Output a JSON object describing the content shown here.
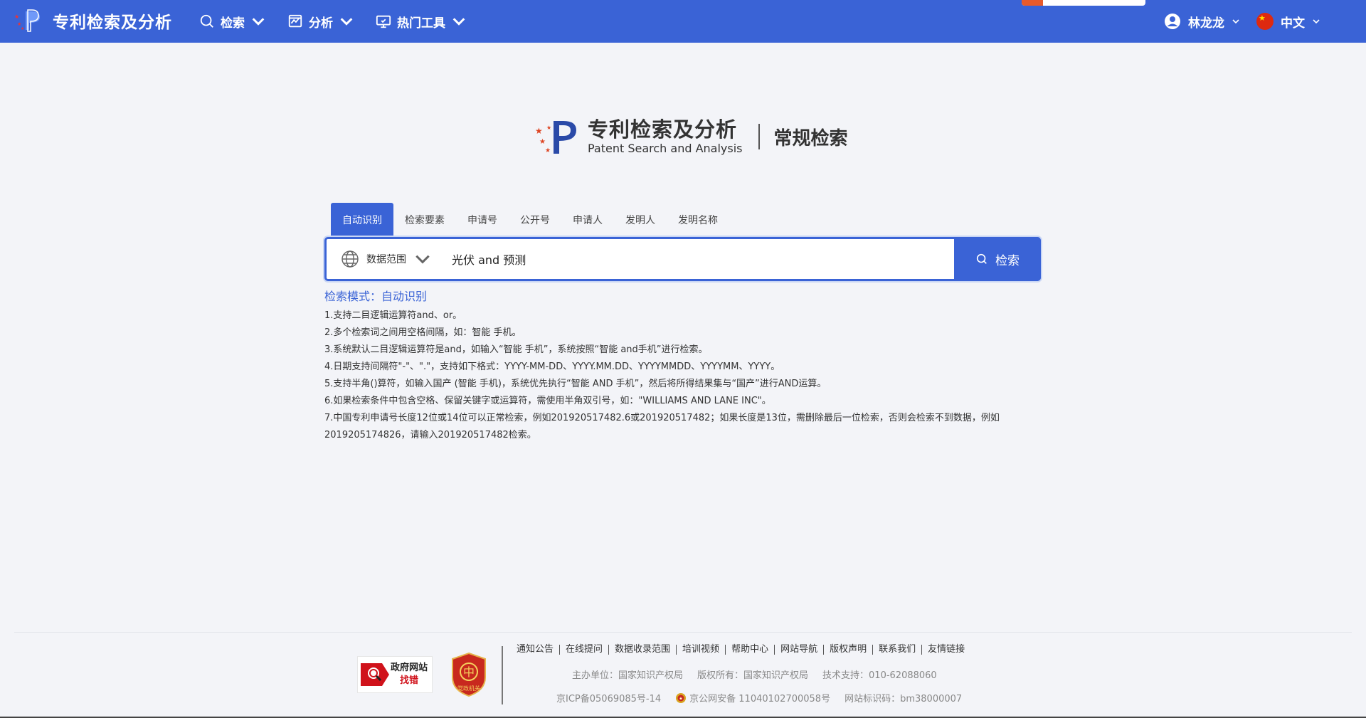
{
  "header": {
    "brand_name": "专利检索及分析",
    "nav": [
      {
        "label": "检索",
        "icon": "search-icon"
      },
      {
        "label": "分析",
        "icon": "chart-icon"
      },
      {
        "label": "热门工具",
        "icon": "monitor-icon"
      }
    ],
    "user_name": "林龙龙",
    "language": "中文"
  },
  "hero": {
    "title_cn": "专利检索及分析",
    "title_en": "Patent Search and Analysis",
    "mode": "常规检索"
  },
  "tabs": [
    "自动识别",
    "检索要素",
    "申请号",
    "公开号",
    "申请人",
    "发明人",
    "发明名称"
  ],
  "search": {
    "scope_label": "数据范围",
    "query": "光伏 and 预测",
    "button_label": "检索"
  },
  "mode_line": "检索模式：自动识别",
  "hints": [
    "1.支持二目逻辑运算符and、or。",
    "2.多个检索词之间用空格间隔，如：智能 手机。",
    "3.系统默认二目逻辑运算符是and，如输入“智能 手机”，系统按照“智能 and手机”进行检索。",
    "4.日期支持间隔符\"-\"、\".\"，支持如下格式：YYYY-MM-DD、YYYY.MM.DD、YYYYMMDD、YYYYMM、YYYY。",
    "5.支持半角()算符，如输入国产 (智能 手机)，系统优先执行“智能 AND 手机”，然后将所得结果集与“国产”进行AND运算。",
    "6.如果检索条件中包含空格、保留关键字或运算符，需使用半角双引号，如：\"WILLIAMS AND LANE INC\"。",
    "7.中国专利申请号长度12位或14位可以正常检索，例如201920517482.6或201920517482；如果长度是13位，需删除最后一位检索，否则会检索不到数据，例如2019205174826，请输入201920517482检索。"
  ],
  "footer": {
    "gov_badge_top": "政府网站",
    "gov_badge_bottom": "找错",
    "party_badge_text": "党政机关",
    "links": [
      "通知公告",
      "在线提问",
      "数据收录范围",
      "培训视频",
      "帮助中心",
      "网站导航",
      "版权声明",
      "联系我们",
      "友情链接"
    ],
    "sponsor": "主办单位：国家知识产权局",
    "copyright": "版权所有：国家知识产权局",
    "support": "技术支持：010-62088060",
    "icp": "京ICP备05069085号-14",
    "police": "京公网安备 11040102700058号",
    "site_code": "网站标识码：bm38000007"
  },
  "colors": {
    "primary": "#3a63d6",
    "background": "#f3f4f8"
  }
}
